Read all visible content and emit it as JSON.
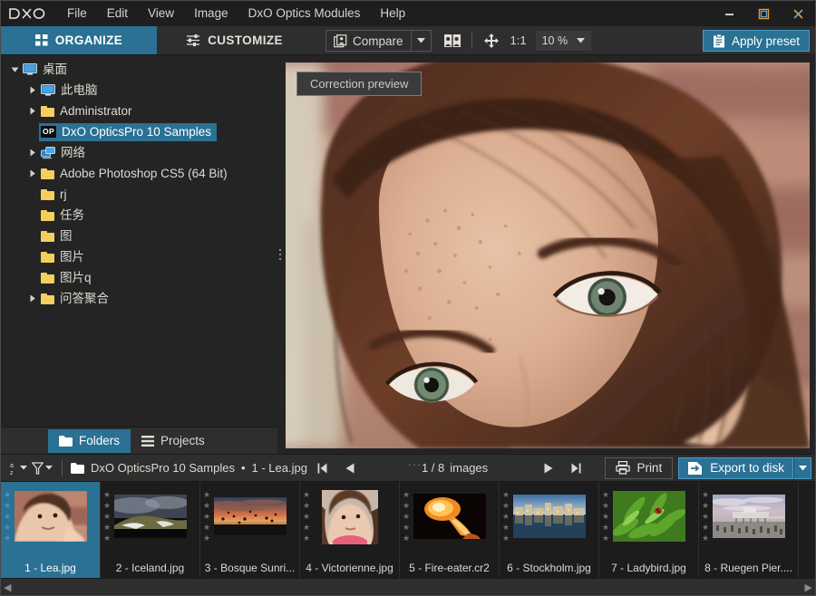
{
  "window": {
    "logo_text": "DXO",
    "minimize_label": "Minimize",
    "maximize_label": "Maximize",
    "close_label": "Close"
  },
  "menubar": {
    "items": [
      {
        "label": "File"
      },
      {
        "label": "Edit"
      },
      {
        "label": "View"
      },
      {
        "label": "Image"
      },
      {
        "label": "DxO Optics Modules"
      },
      {
        "label": "Help"
      }
    ]
  },
  "toolbar": {
    "organize_label": "ORGANIZE",
    "customize_label": "CUSTOMIZE",
    "compare_label": "Compare",
    "compare_dropdown_label": "Compare options",
    "side_by_side_label": "Side by side view",
    "pan_label": "Pan tool",
    "ratio_label": "1:1",
    "zoom_value": "10 %",
    "zoom_dropdown_label": "Zoom level",
    "apply_preset_label": "Apply preset",
    "accent_color": "#2a7194"
  },
  "sidebar": {
    "tree": [
      {
        "label": "桌面",
        "indent": 0,
        "twisty": "down",
        "icon": "monitor",
        "selected": false
      },
      {
        "label": "此电脑",
        "indent": 1,
        "twisty": "right",
        "icon": "monitor",
        "selected": false
      },
      {
        "label": "Administrator",
        "indent": 1,
        "twisty": "right",
        "icon": "folder",
        "selected": false
      },
      {
        "label": "DxO OpticsPro 10 Samples",
        "indent": 1,
        "twisty": "none",
        "icon": "op-badge",
        "selected": true
      },
      {
        "label": "网络",
        "indent": 1,
        "twisty": "right",
        "icon": "network",
        "selected": false
      },
      {
        "label": "Adobe Photoshop CS5 (64 Bit)",
        "indent": 1,
        "twisty": "right",
        "icon": "folder",
        "selected": false
      },
      {
        "label": "rj",
        "indent": 1,
        "twisty": "none",
        "icon": "folder",
        "selected": false
      },
      {
        "label": "任务",
        "indent": 1,
        "twisty": "none",
        "icon": "folder",
        "selected": false
      },
      {
        "label": "图",
        "indent": 1,
        "twisty": "none",
        "icon": "folder",
        "selected": false
      },
      {
        "label": "图片",
        "indent": 1,
        "twisty": "none",
        "icon": "folder",
        "selected": false
      },
      {
        "label": "图片q",
        "indent": 1,
        "twisty": "none",
        "icon": "folder",
        "selected": false
      },
      {
        "label": "问答聚合",
        "indent": 1,
        "twisty": "right",
        "icon": "folder",
        "selected": false
      }
    ],
    "op_badge_text": "OP",
    "tabs": [
      {
        "label": "Folders",
        "icon": "folder-icon",
        "active": true
      },
      {
        "label": "Projects",
        "icon": "list-icon",
        "active": false
      }
    ]
  },
  "viewer": {
    "tooltip_label": "Correction preview"
  },
  "statusbar": {
    "sort_label": "Sort order",
    "filter_label": "Filter",
    "folder_name": "DxO OpticsPro 10 Samples",
    "separator": "•",
    "current_file": "1 - Lea.jpg",
    "first_label": "First image",
    "prev_label": "Previous image",
    "next_label": "Next image",
    "last_label": "Last image",
    "counter": "1 / 8",
    "counter_unit": "images",
    "overflow_dots": "...",
    "print_label": "Print",
    "export_label": "Export to disk",
    "export_dropdown_label": "Export options"
  },
  "filmstrip": {
    "stars_per_thumb": 5,
    "items": [
      {
        "caption": "1 - Lea.jpg",
        "selected": true,
        "thumb": "lea"
      },
      {
        "caption": "2 - Iceland.jpg",
        "selected": false,
        "thumb": "iceland"
      },
      {
        "caption": "3 - Bosque Sunri...",
        "selected": false,
        "thumb": "bosque"
      },
      {
        "caption": "4 - Victorienne.jpg",
        "selected": false,
        "thumb": "victorienne"
      },
      {
        "caption": "5 - Fire-eater.cr2",
        "selected": false,
        "thumb": "fireeater"
      },
      {
        "caption": "6 - Stockholm.jpg",
        "selected": false,
        "thumb": "stockholm"
      },
      {
        "caption": "7 - Ladybird.jpg",
        "selected": false,
        "thumb": "ladybird"
      },
      {
        "caption": "8 - Ruegen Pier....",
        "selected": false,
        "thumb": "ruegen"
      }
    ],
    "scroll_left_label": "Scroll left",
    "scroll_right_label": "Scroll right"
  }
}
